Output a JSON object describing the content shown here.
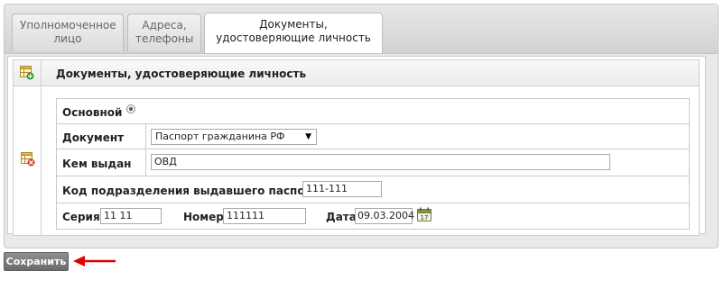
{
  "tabs": [
    {
      "label": "Уполномоченное лицо",
      "active": false
    },
    {
      "label": "Адреса, телефоны",
      "active": false
    },
    {
      "label": "Документы, удостоверяющие личность",
      "active": true
    }
  ],
  "section": {
    "title": "Документы, удостоверяющие личность"
  },
  "form": {
    "main_label": "Основной",
    "main_selected": true,
    "document_label": "Документ",
    "document_value": "Паспорт гражданина РФ",
    "issued_by_label": "Кем выдан",
    "issued_by_value": "ОВД",
    "dept_code_label": "Код подразделения выдавшего паспорт",
    "dept_code_value": "111-111",
    "series_label": "Серия",
    "series_value": "11 11",
    "number_label": "Номер",
    "number_value": "111111",
    "date_label": "Дата",
    "date_value": "09.03.2004",
    "calendar_day": "17"
  },
  "save_label": "Сохранить",
  "colors": {
    "arrow": "#e00000",
    "save_button": "#7a7a7a",
    "add_icon": "#2f9e2f",
    "delete_icon": "#d23a2a"
  },
  "icons": [
    "table-add-icon",
    "table-delete-icon",
    "radio-icon",
    "dropdown-arrow-icon",
    "calendar-icon",
    "red-arrow-icon"
  ]
}
